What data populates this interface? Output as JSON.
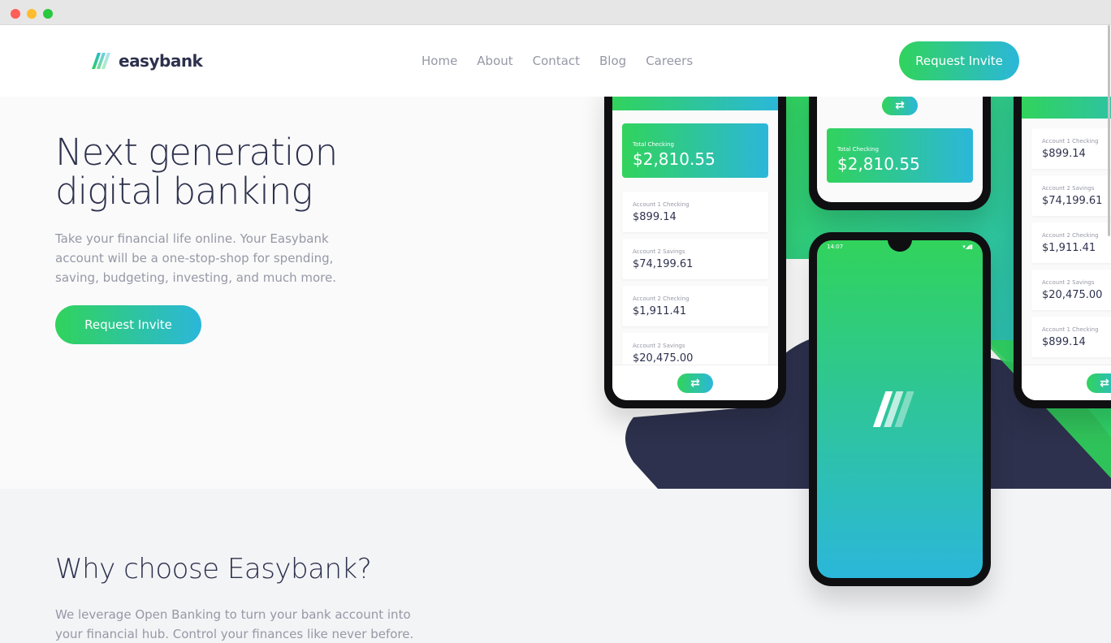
{
  "window": {
    "controls": [
      "close",
      "minimize",
      "maximize"
    ]
  },
  "brand": {
    "name": "easybank",
    "logo_icon": "easybank-logo-icon"
  },
  "nav": {
    "items": [
      "Home",
      "About",
      "Contact",
      "Blog",
      "Careers"
    ]
  },
  "header": {
    "cta_label": "Request Invite"
  },
  "hero": {
    "title": "Next generation digital banking",
    "text": "Take your financial life online. Your Easybank account will be a one-stop-shop for spending, saving, budgeting, investing, and much more.",
    "cta_label": "Request Invite"
  },
  "mockups": {
    "phone_left": {
      "total_label": "Total Checking",
      "total_amount": "$2,810.55",
      "accounts": [
        {
          "label": "Account 1 Checking",
          "amount": "$899.14"
        },
        {
          "label": "Account 2 Savings",
          "amount": "$74,199.61"
        },
        {
          "label": "Account 2 Checking",
          "amount": "$1,911.41"
        },
        {
          "label": "Account 2 Savings",
          "amount": "$20,475.00"
        }
      ]
    },
    "phone_top_center": {
      "total_label": "Total Checking",
      "total_amount": "$2,810.55"
    },
    "phone_center": {
      "status_time": "14:07"
    },
    "phone_right": {
      "accounts": [
        {
          "label": "Account 1 Checking",
          "amount": "$899.14"
        },
        {
          "label": "Account 2 Savings",
          "amount": "$74,199.61"
        },
        {
          "label": "Account 2 Checking",
          "amount": "$1,911.41"
        },
        {
          "label": "Account 2 Savings",
          "amount": "$20,475.00"
        },
        {
          "label": "Account 1 Checking",
          "amount": "$899.14"
        }
      ]
    }
  },
  "why": {
    "title": "Why choose Easybank?",
    "text": "We leverage Open Banking to turn your bank account into your financial hub. Control your finances like never before."
  },
  "colors": {
    "primary_dark": "#2d314d",
    "green": "#31d35c",
    "cyan": "#2bb7da",
    "grey_text": "#9698a6"
  }
}
